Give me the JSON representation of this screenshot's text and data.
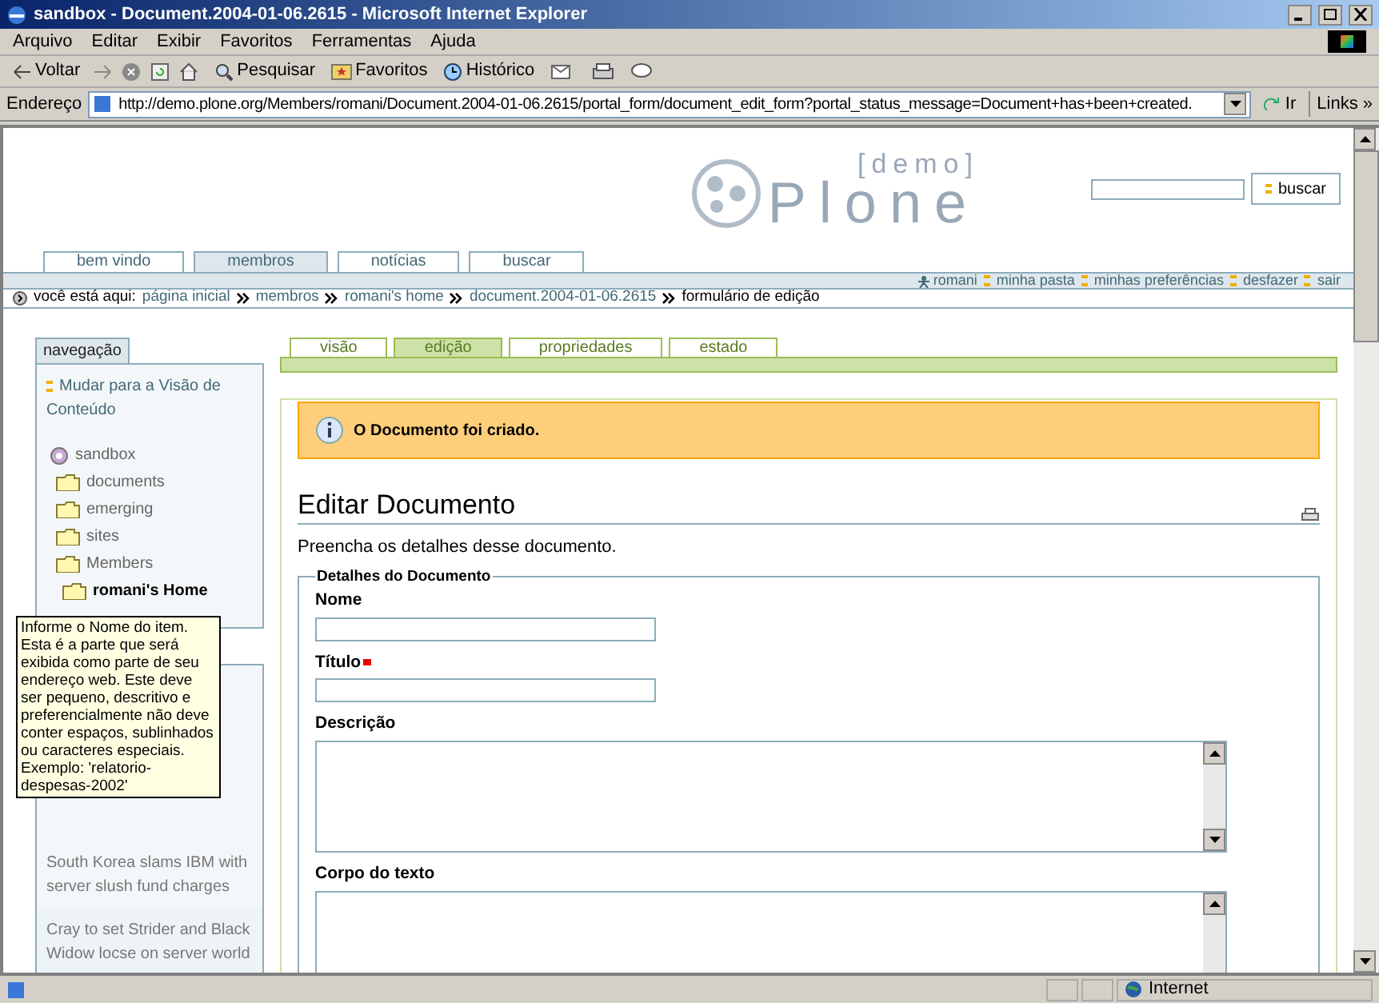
{
  "window": {
    "title": "sandbox - Document.2004-01-06.2615 - Microsoft Internet Explorer"
  },
  "menu": [
    "Arquivo",
    "Editar",
    "Exibir",
    "Favoritos",
    "Ferramentas",
    "Ajuda"
  ],
  "toolbar": [
    {
      "kind": "back",
      "label": "Voltar"
    },
    {
      "kind": "search",
      "label": "Pesquisar"
    },
    {
      "kind": "favorites",
      "label": "Favoritos"
    },
    {
      "kind": "history",
      "label": "Histórico"
    }
  ],
  "address_bar": {
    "label": "Endereço",
    "value": "http://demo.plone.org/Members/romani/Document.2004-01-06.2615/portal_form/document_edit_form?portal_status_message=Document+has+been+created.",
    "go": "Ir",
    "links": "Links »"
  },
  "header": {
    "logo_tag": "[demo]",
    "logo": "Plone",
    "search_button": "buscar"
  },
  "site_tabs": [
    {
      "label": "bem vindo",
      "selected": false
    },
    {
      "label": "membros",
      "selected": true
    },
    {
      "label": "notícias",
      "selected": false
    },
    {
      "label": "buscar",
      "selected": false
    }
  ],
  "user_links": [
    "romani",
    "minha pasta",
    "minhas preferências",
    "desfazer",
    "sair"
  ],
  "breadcrumb": {
    "label": "você está aqui:",
    "items": [
      "página inicial",
      "membros",
      "romani's home",
      "document.2004-01-06.2615"
    ],
    "current": "formulário de edição"
  },
  "navigation": {
    "title": "navegação",
    "switch_link": "Mudar para a Visão de Conteúdo",
    "tree": [
      {
        "label": "sandbox",
        "kind": "site",
        "selected": false,
        "children": [
          {
            "label": "documents",
            "kind": "folder",
            "selected": false
          },
          {
            "label": "emerging",
            "kind": "folder",
            "selected": false
          },
          {
            "label": "sites",
            "kind": "folder",
            "selected": false
          },
          {
            "label": "Members",
            "kind": "folder",
            "selected": false,
            "children": [
              {
                "label": "romani's Home",
                "kind": "folder",
                "selected": true
              }
            ]
          }
        ]
      }
    ]
  },
  "news": [
    "South Korea slams IBM with server slush fund charges",
    "Cray to set Strider and Black Widow locse on server world"
  ],
  "tooltip": "Informe o Nome do item. Esta é a parte que será exibida como parte de seu endereço web. Este deve ser pequeno, descritivo e preferencialmente não deve conter espaços, sublinhados ou caracteres especiais. Exemplo: 'relatorio-despesas-2002'",
  "content_tabs": [
    {
      "label": "visão",
      "selected": false
    },
    {
      "label": "edição",
      "selected": true
    },
    {
      "label": "propriedades",
      "selected": false
    },
    {
      "label": "estado",
      "selected": false
    }
  ],
  "message": "O Documento foi criado.",
  "form": {
    "title": "Editar Documento",
    "description": "Preencha os detalhes desse documento.",
    "legend": "Detalhes do Documento",
    "fields": [
      {
        "label": "Nome",
        "kind": "text",
        "required": false
      },
      {
        "label": "Título",
        "kind": "text",
        "required": true
      },
      {
        "label": "Descrição",
        "kind": "textarea",
        "required": false
      },
      {
        "label": "Corpo do texto",
        "kind": "textarea",
        "required": false
      }
    ]
  },
  "status_bar": {
    "zone": "Internet"
  }
}
